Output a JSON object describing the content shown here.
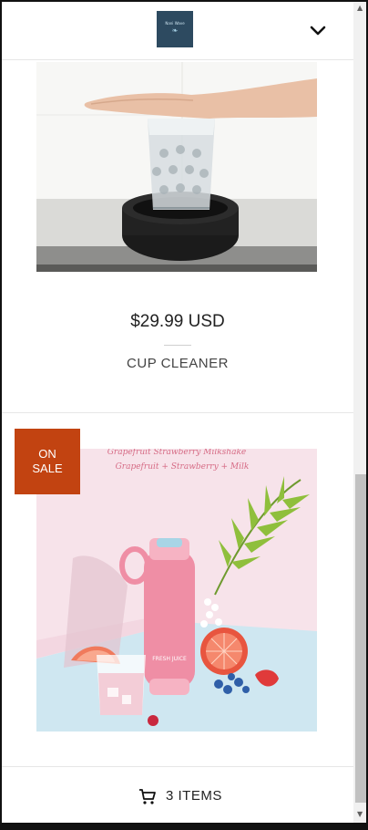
{
  "header": {
    "logo_text": "Nani Wave",
    "logo_icon": "leaf-icon",
    "menu_icon": "chevron-down-icon"
  },
  "products": [
    {
      "price": "$29.99 USD",
      "name": "CUP CLEANER",
      "image_icon": "product-image-cup-cleaner"
    },
    {
      "badge_line1": "ON",
      "badge_line2": "SALE",
      "image_caption_line1": "Grapefruit Strawberry Milkshake",
      "image_caption_line2": "Grapefruit + Strawberry + Milk",
      "bottle_label": "FRESH JUICE",
      "image_icon": "product-image-juice-blender"
    }
  ],
  "cart": {
    "label": "3 ITEMS",
    "icon": "cart-icon"
  },
  "colors": {
    "sale_badge": "#c24311",
    "logo_bg": "#2d4a60"
  }
}
